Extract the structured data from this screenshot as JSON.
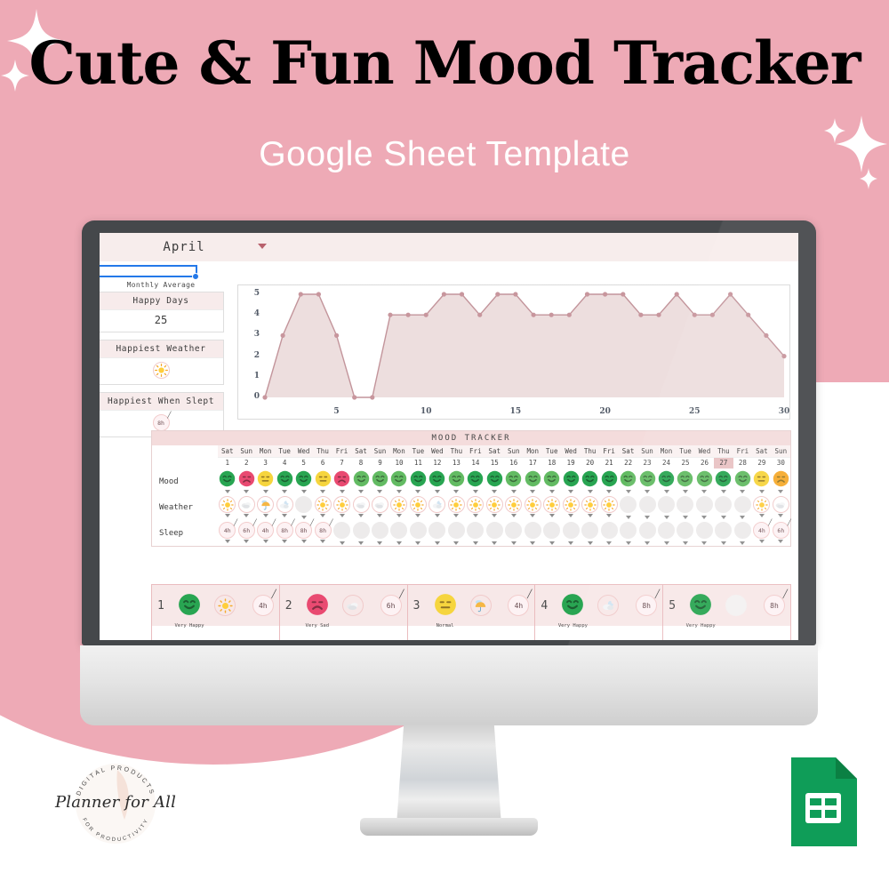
{
  "header": {
    "title": "Cute & Fun Mood Tracker",
    "subtitle": "Google Sheet Template",
    "title_color": "#000000",
    "subtitle_color": "#ffffff",
    "background_color": "#eeaab6"
  },
  "sheet": {
    "month_selector": {
      "value": "April",
      "icon": "chevron-down-icon"
    },
    "sidebar": {
      "section_label": "Monthly Average",
      "cards": [
        {
          "title": "Happy Days",
          "value": "25",
          "value_type": "number"
        },
        {
          "title": "Happiest Weather",
          "value": "",
          "value_type": "icon",
          "icon": "sun-icon"
        },
        {
          "title": "Happiest When Slept",
          "value": "8h",
          "value_type": "chip"
        }
      ]
    },
    "tracker": {
      "title": "MOOD TRACKER",
      "row_labels": [
        "Mood",
        "Weather",
        "Sleep"
      ],
      "selected_day": 27,
      "weekdays": [
        "Sat",
        "Sun",
        "Mon",
        "Tue",
        "Wed",
        "Thu",
        "Fri",
        "Sat",
        "Sun",
        "Mon",
        "Tue",
        "Wed",
        "Thu",
        "Fri",
        "Sat",
        "Sun",
        "Mon",
        "Tue",
        "Wed",
        "Thu",
        "Fri",
        "Sat",
        "Sun",
        "Mon",
        "Tue",
        "Wed",
        "Thu",
        "Fri",
        "Sat",
        "Sun"
      ],
      "days": [
        1,
        2,
        3,
        4,
        5,
        6,
        7,
        8,
        9,
        10,
        11,
        12,
        13,
        14,
        15,
        16,
        17,
        18,
        19,
        20,
        21,
        22,
        23,
        24,
        25,
        26,
        27,
        28,
        29,
        30
      ],
      "mood": [
        "very-happy",
        "very-sad",
        "normal",
        "very-happy",
        "very-happy",
        "normal",
        "very-sad",
        "happy",
        "happy",
        "happy",
        "very-happy",
        "very-happy",
        "happy",
        "very-happy",
        "very-happy",
        "happy",
        "happy",
        "happy",
        "very-happy",
        "very-happy",
        "very-happy",
        "happy",
        "happy",
        "very-happy",
        "happy",
        "happy",
        "very-happy",
        "happy",
        "normal",
        "sad"
      ],
      "weather": [
        "sun",
        "cloudy",
        "rain",
        "partly-cloudy",
        "empty",
        "sun",
        "sun",
        "cloudy",
        "cloudy",
        "sun",
        "sun",
        "cloud-moon",
        "sun",
        "sun",
        "sun",
        "sun",
        "sun",
        "sun",
        "sun",
        "sun",
        "sun",
        "empty",
        "empty",
        "empty",
        "empty",
        "empty",
        "empty",
        "empty",
        "sun",
        "cloudy"
      ],
      "sleep": [
        "4h",
        "6h",
        "4h",
        "8h",
        "8h",
        "8h",
        "",
        "",
        "",
        "",
        "",
        "",
        "",
        "",
        "",
        "",
        "",
        "",
        "",
        "",
        "",
        "",
        "",
        "",
        "",
        "",
        "",
        "",
        "4h",
        "6h"
      ]
    },
    "day_cards": [
      {
        "number": "1",
        "mood": "very-happy",
        "mood_label": "Very Happy",
        "weather": "sun",
        "sleep": "4h"
      },
      {
        "number": "2",
        "mood": "very-sad",
        "mood_label": "Very Sad",
        "weather": "cloudy",
        "sleep": "6h"
      },
      {
        "number": "3",
        "mood": "normal",
        "mood_label": "Normal",
        "weather": "rain",
        "sleep": "4h"
      },
      {
        "number": "4",
        "mood": "very-happy",
        "mood_label": "Very Happy",
        "weather": "cloud-moon",
        "sleep": "8h"
      },
      {
        "number": "5",
        "mood": "very-happy",
        "mood_label": "Very Happy",
        "weather": "empty",
        "sleep": "8h"
      }
    ]
  },
  "chart_data": {
    "type": "area",
    "title": "",
    "xlabel": "",
    "ylabel": "",
    "x": [
      1,
      2,
      3,
      4,
      5,
      6,
      7,
      8,
      9,
      10,
      11,
      12,
      13,
      14,
      15,
      16,
      17,
      18,
      19,
      20,
      21,
      22,
      23,
      24,
      25,
      26,
      27,
      28,
      29,
      30
    ],
    "values": [
      0,
      3,
      5,
      5,
      3,
      0,
      0,
      4,
      4,
      4,
      5,
      5,
      4,
      5,
      5,
      4,
      4,
      4,
      5,
      5,
      5,
      4,
      4,
      5,
      4,
      4,
      5,
      4,
      3,
      2
    ],
    "xticks": [
      5,
      10,
      15,
      20,
      25,
      30
    ],
    "yticks": [
      0,
      1,
      2,
      3,
      4,
      5
    ],
    "ylim": [
      0,
      5
    ],
    "xlim": [
      1,
      30
    ],
    "grid": false,
    "legend": "none",
    "line_color": "#c09097",
    "fill_color": "#ecdcdc",
    "marker_color": "#c59199"
  },
  "footer": {
    "logo": {
      "brand": "Planner for All",
      "arc_top": "DIGITAL PRODUCTS",
      "arc_bottom": "FOR PRODUCTIVITY"
    },
    "app_icon": "google-sheets-icon"
  },
  "palette": {
    "pink_bg": "#eeaab6",
    "sheet_header_pink": "#f7eceb",
    "tracker_title_pink": "#f3dada",
    "green_happy": "#1fa14a",
    "green_light": "#7dc242",
    "yellow": "#f6d335",
    "orange": "#f5a623",
    "pink_sad": "#e8426b",
    "bezel": "#3d4043",
    "google_green": "#0f9d58"
  }
}
